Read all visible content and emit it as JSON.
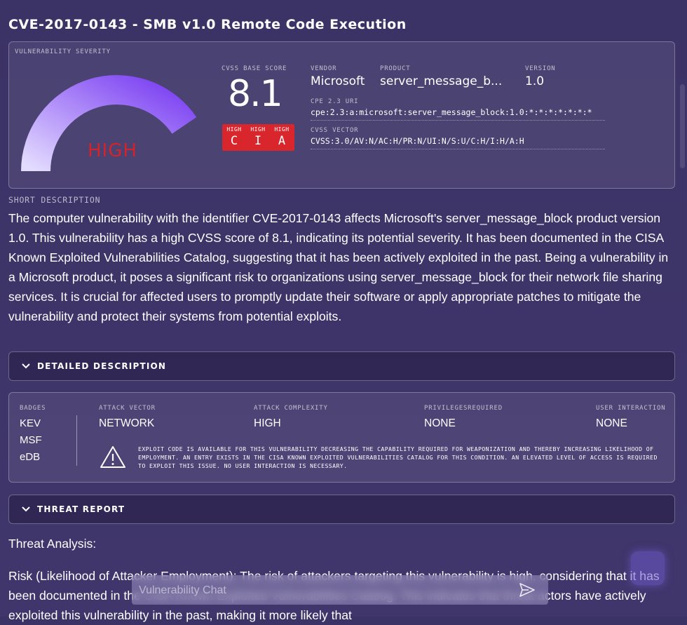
{
  "page": {
    "title": "CVE-2017-0143 - SMB v1.0 Remote Code Execution"
  },
  "severity": {
    "section_label": "VULNERABILITY SEVERITY",
    "rating": "HIGH",
    "gauge_fill": 0.81,
    "colors": {
      "gauge_start": "#e4dcff",
      "gauge_end": "#7b3ff2",
      "rating": "#d5232b"
    }
  },
  "score": {
    "label": "CVSS BASE SCORE",
    "value": "8.1",
    "cia": [
      {
        "level": "HIGH",
        "letter": "C"
      },
      {
        "level": "HIGH",
        "letter": "I"
      },
      {
        "level": "HIGH",
        "letter": "A"
      }
    ],
    "cia_color": "#d8262c"
  },
  "details": {
    "vendor_label": "VENDOR",
    "vendor": "Microsoft",
    "product_label": "PRODUCT",
    "product": "server_message_b...",
    "version_label": "VERSION",
    "version": "1.0",
    "cpe_label": "CPE 2.3 URI",
    "cpe": "cpe:2.3:a:microsoft:server_message_block:1.0:*:*:*:*:*:*:*",
    "vector_label": "CVSS VECTOR",
    "vector": "CVSS:3.0/AV:N/AC:H/PR:N/UI:N/S:U/C:H/I:H/A:H"
  },
  "short_description": {
    "label": "SHORT DESCRIPTION",
    "text": "The computer vulnerability with the identifier CVE-2017-0143 affects Microsoft's server_message_block product version 1.0. This vulnerability has a high CVSS score of 8.1, indicating its potential severity. It has been documented in the CISA Known Exploited Vulnerabilities Catalog, suggesting that it has been actively exploited in the past. Being a vulnerability in a Microsoft product, it poses a significant risk to organizations using server_message_block for their network file sharing services. It is crucial for affected users to promptly update their software or apply appropriate patches to mitigate the vulnerability and protect their systems from potential exploits."
  },
  "accordions": {
    "detailed": "DETAILED DESCRIPTION",
    "threat": "THREAT REPORT"
  },
  "metrics": {
    "badges_label": "BADGES",
    "badges": [
      "KEV",
      "MSF",
      "eDB"
    ],
    "attack_vector_label": "ATTACK VECTOR",
    "attack_vector": "NETWORK",
    "attack_complexity_label": "ATTACK COMPLEXITY",
    "attack_complexity": "HIGH",
    "privileges_label": "PRIVILEGESREQUIRED",
    "privileges": "NONE",
    "user_interaction_label": "USER INTERACTION",
    "user_interaction": "NONE",
    "exploit_note": "Exploit code is available for this vulnerability decreasing the capability required for weaponization and thereby increasing likelihood of employment. An entry exists in the CISA Known Exploited Vulnerabilities Catalog for this condition. An elevated level of access is required to exploit this issue. No user interaction is necessary."
  },
  "threat": {
    "heading": "Threat Analysis:",
    "body": "Risk (Likelihood of Attacker Employment): The risk of attackers targeting this vulnerability is high, considering that it has been documented in the CISA Known Exploited Vulnerabilities Catalog. This indicates that threat actors have actively exploited this vulnerability in the past, making it more likely that"
  },
  "chat": {
    "placeholder": "Vulnerability Chat",
    "send_icon": "send-icon"
  }
}
